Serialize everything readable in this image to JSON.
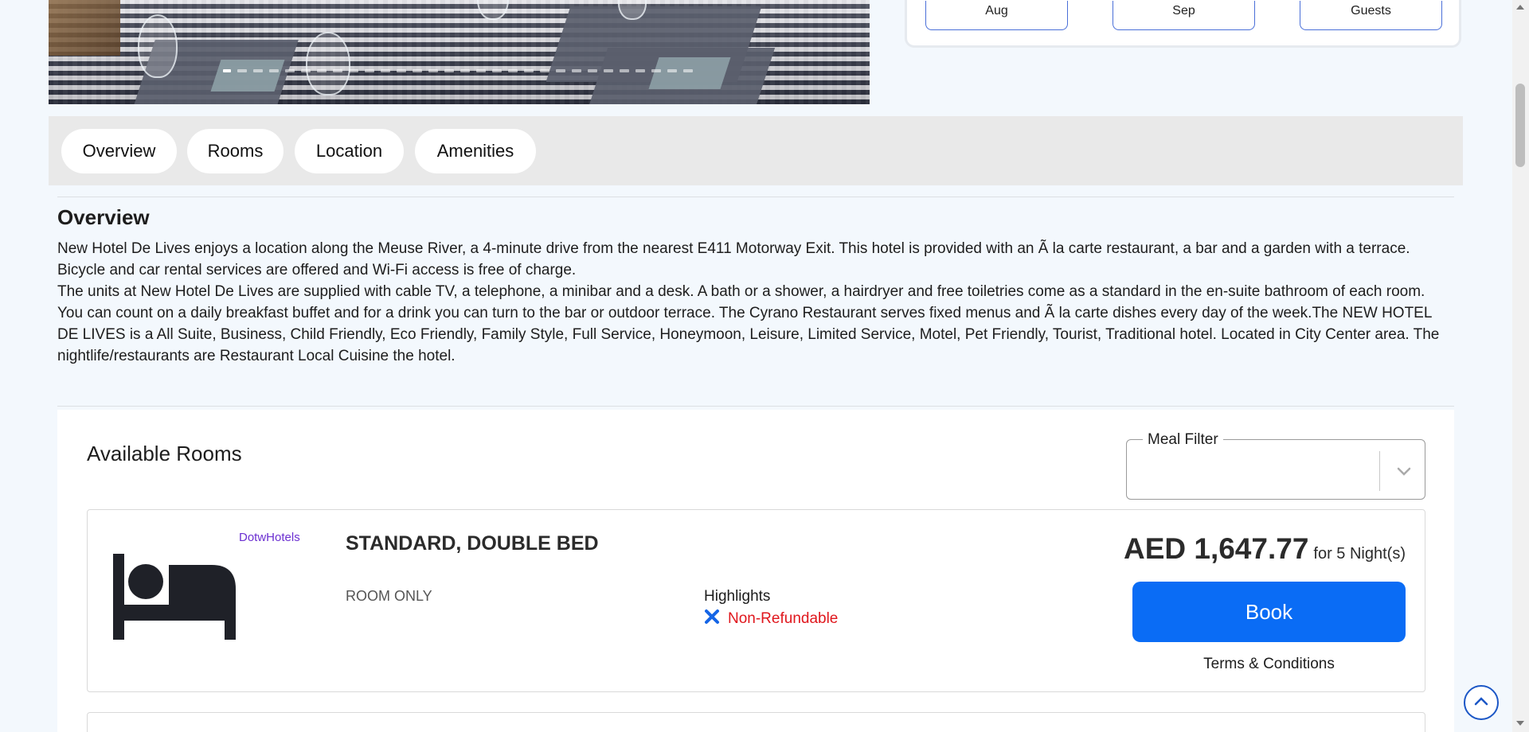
{
  "booking": {
    "checkin_label": "Aug",
    "checkout_label": "Sep",
    "guests_label": "Guests"
  },
  "gallery": {
    "slide_count": 30,
    "active_slide": 1
  },
  "tabs": [
    {
      "label": "Overview"
    },
    {
      "label": "Rooms"
    },
    {
      "label": "Location"
    },
    {
      "label": "Amenities"
    }
  ],
  "overview": {
    "title": "Overview",
    "paragraph_1": "New Hotel De Lives enjoys a location along the Meuse River, a 4-minute drive from the nearest E411 Motorway Exit. This hotel is provided with an Ã  la carte restaurant, a bar and a garden with a terrace. Bicycle and car rental services are offered and Wi-Fi access is free of charge.",
    "paragraph_2": "The units at New Hotel De Lives are supplied with cable TV, a telephone, a minibar and a desk. A bath or a shower, a hairdryer and free toiletries come as a standard in the en-suite bathroom of each room.",
    "paragraph_3": "You can count on a daily breakfast buffet and for a drink you can turn to the bar or outdoor terrace. The Cyrano Restaurant serves fixed menus and Ã  la carte dishes every day of the week.The NEW HOTEL DE LIVES is a All Suite, Business, Child Friendly, Eco Friendly, Family Style, Full Service, Honeymoon, Leisure, Limited Service, Motel, Pet Friendly, Tourist, Traditional hotel. Located in City Center area. The nightlife/restaurants are Restaurant Local Cuisine the hotel."
  },
  "rooms": {
    "title": "Available Rooms",
    "meal_filter_label": "Meal Filter",
    "meal_filter_value": "",
    "items": [
      {
        "supplier": "DotwHotels",
        "name": "STANDARD, DOUBLE BED",
        "board": "ROOM ONLY",
        "highlights_label": "Highlights",
        "highlight": "Non-Refundable",
        "price": "AED 1,647.77",
        "price_suffix": "for 5 Night(s)",
        "book_label": "Book",
        "terms_label": "Terms & Conditions"
      }
    ]
  },
  "colors": {
    "primary": "#0a6cf5",
    "supplier": "#6b2fd1",
    "non_refundable": "#e0171d",
    "x_icon": "#1565e6",
    "background": "#f3f8fd"
  },
  "icons": {
    "room": "bed-icon",
    "highlight": "close-x-icon",
    "meal_filter": "chevron-down-icon",
    "back_to_top": "chevron-up-icon"
  }
}
